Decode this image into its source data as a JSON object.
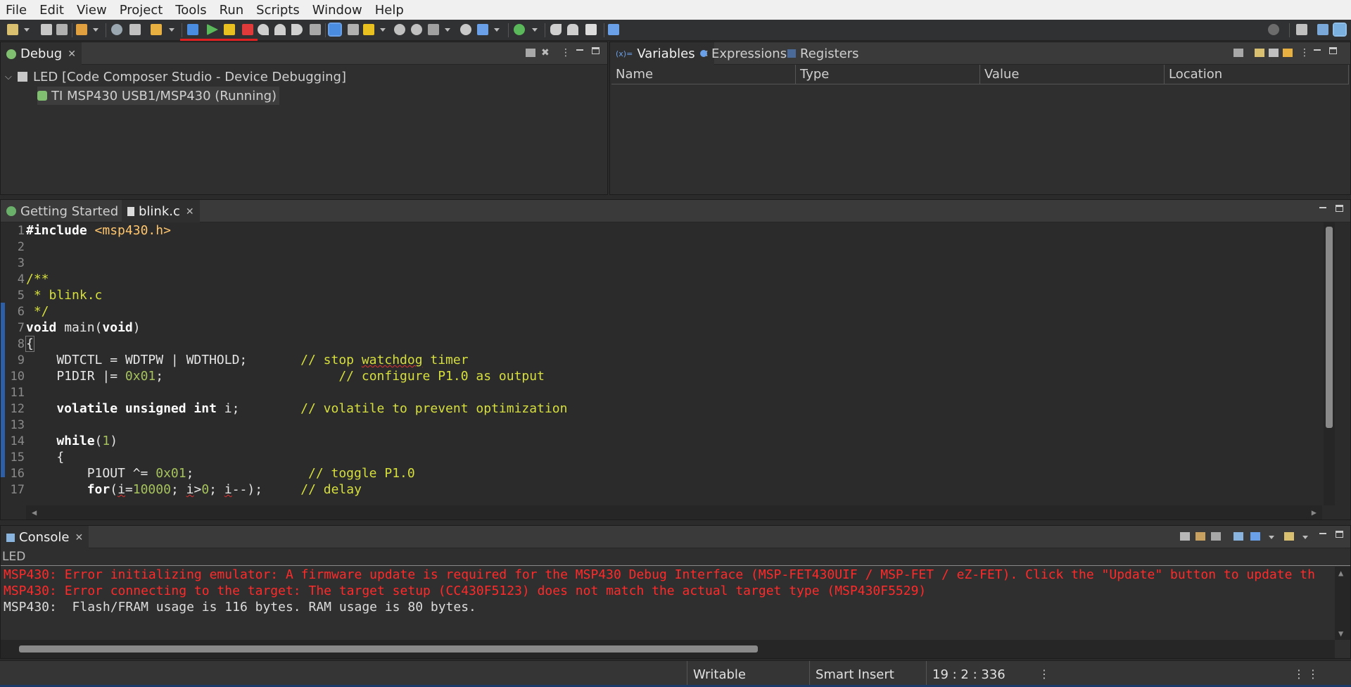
{
  "menubar": {
    "items": [
      {
        "label": "File"
      },
      {
        "label": "Edit"
      },
      {
        "label": "View"
      },
      {
        "label": "Project"
      },
      {
        "label": "Tools"
      },
      {
        "label": "Run"
      },
      {
        "label": "Scripts"
      },
      {
        "label": "Window"
      },
      {
        "label": "Help"
      }
    ]
  },
  "debug_view": {
    "tab_label": "Debug",
    "launch": "LED [Code Composer Studio - Device Debugging]",
    "target": "TI MSP430 USB1/MSP430 (Running)"
  },
  "variables_view": {
    "tabs": [
      "Variables",
      "Expressions",
      "Registers"
    ],
    "columns": [
      "Name",
      "Type",
      "Value",
      "Location"
    ]
  },
  "editor": {
    "tabs": [
      "Getting Started",
      "blink.c"
    ],
    "lines": [
      {
        "n": "1"
      },
      {
        "n": "2"
      },
      {
        "n": "3"
      },
      {
        "n": "4"
      },
      {
        "n": "5"
      },
      {
        "n": "6"
      },
      {
        "n": "7"
      },
      {
        "n": "8"
      },
      {
        "n": "9"
      },
      {
        "n": "10"
      },
      {
        "n": "11"
      },
      {
        "n": "12"
      },
      {
        "n": "13"
      },
      {
        "n": "14"
      },
      {
        "n": "15"
      },
      {
        "n": "16"
      },
      {
        "n": "17"
      }
    ],
    "code": {
      "l1_kw": "#include ",
      "l1_str": "<msp430.h>",
      "l4": "/**",
      "l5": " * blink.c",
      "l6": " */",
      "l7_a": "void",
      "l7_b": " main(",
      "l7_c": "void",
      "l7_d": ")",
      "l8": "{",
      "l9_code": "    WDTCTL = WDTPW | WDTHOLD;       ",
      "l9_cmt_a": "// stop ",
      "l9_cmt_b": "watchdog",
      "l9_cmt_c": " timer",
      "l10_code": "    P1DIR |= ",
      "l10_num": "0x01",
      "l10_pad": ";                       ",
      "l10_cmt": "// configure P1.0 as output",
      "l12_kw": "    volatile unsigned int",
      "l12_code": " i;        ",
      "l12_cmt": "// volatile to prevent optimization",
      "l14_kw": "    while",
      "l14_a": "(",
      "l14_num": "1",
      "l14_b": ")",
      "l15": "    {",
      "l16_code": "        P1OUT ^= ",
      "l16_num": "0x01",
      "l16_pad": ";               ",
      "l16_cmt": "// toggle P1.0",
      "l17_kw": "        for",
      "l17_a": "(",
      "l17_b": "i",
      "l17_c": "=",
      "l17_num": "10000",
      "l17_d": "; ",
      "l17_e": "i",
      "l17_f": ">",
      "l17_num2": "0",
      "l17_g": "; ",
      "l17_h": "i",
      "l17_i": "--);     ",
      "l17_cmt": "// delay"
    }
  },
  "console": {
    "tab_label": "Console",
    "name": "LED",
    "lines": [
      "MSP430: Error initializing emulator: A firmware update is required for the MSP430 Debug Interface (MSP-FET430UIF / MSP-FET / eZ-FET). Click the \"Update\" button to update th",
      "MSP430: Error connecting to the target: The target setup (CC430F5123) does not match the actual target type (MSP430F5529)",
      "MSP430:  Flash/FRAM usage is 116 bytes. RAM usage is 80 bytes."
    ]
  },
  "statusbar": {
    "writable": "Writable",
    "insert_mode": "Smart Insert",
    "position": "19 : 2 : 336"
  },
  "colors": {
    "error": "#ff2a2a",
    "comment": "#d6df3e",
    "string": "#ffc66d",
    "number": "#a5c25c",
    "highlight_red": "#e02020"
  }
}
